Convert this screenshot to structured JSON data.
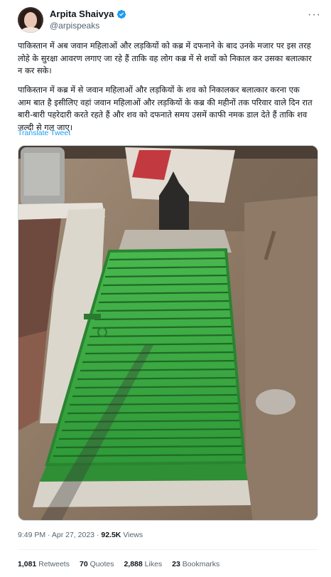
{
  "user": {
    "display_name": "Arpita Shaivya",
    "handle": "@arpispeaks",
    "verified_color": "#1d9bf0"
  },
  "tweet": {
    "paragraph_1": "पाकिस्तान में अब जवान महिलाओं और लड़कियों को कब्र में दफनाने के बाद उनके मजार पर इस तरह लोहे के सुरक्षा आवरण लगाए जा रहे हैं ताकि वह लोग कब्र में से शवों को निकाल कर उसका बलात्कार न कर सके।",
    "paragraph_2": "पाकिस्तान में कब्र में से जवान महिलाओं और लड़कियों के शव को निकालकर बलात्कार करना एक आम बात है इसीलिए वहां जवान महिलाओं और लड़कियों के कब्र की महीनों तक परिवार वाले दिन रात बारी-बारी पहरेदारी करते रहते हैं और शव को दफनाते समय उसमें काफी नमक डाल देते हैं ताकि शव जल्दी से गल जाए।",
    "translate_label": "Translate Tweet",
    "photo_icon": "grave-with-green-metal-grate-photo"
  },
  "meta": {
    "time": "9:49 PM",
    "separator": "·",
    "date": "Apr 27, 2023",
    "views_count": "92.5K",
    "views_label": "Views"
  },
  "stats": {
    "retweets_count": "1,081",
    "retweets_label": "Retweets",
    "quotes_count": "70",
    "quotes_label": "Quotes",
    "likes_count": "2,888",
    "likes_label": "Likes",
    "bookmarks_count": "23",
    "bookmarks_label": "Bookmarks"
  },
  "colors": {
    "text": "#0f1419",
    "secondary": "#536471",
    "link": "#1d9bf0",
    "grate_green": "#3fae45"
  }
}
